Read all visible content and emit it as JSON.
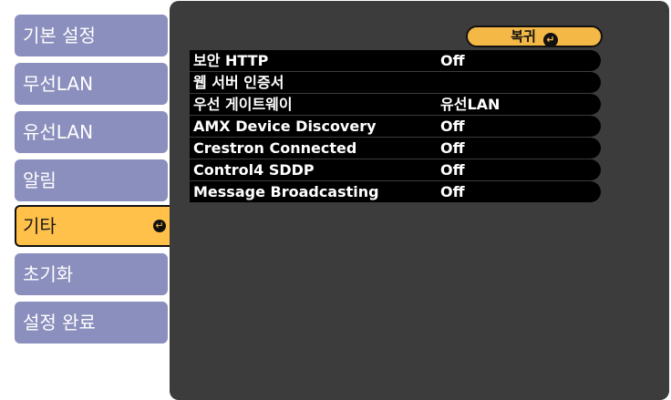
{
  "sidebar": {
    "items": [
      {
        "label": "기본 설정"
      },
      {
        "label": "무선LAN"
      },
      {
        "label": "유선LAN"
      },
      {
        "label": "알림"
      },
      {
        "label": "기타"
      },
      {
        "label": "초기화"
      },
      {
        "label": "설정 완료"
      }
    ],
    "active_index": 4
  },
  "main": {
    "return_label": "복귀",
    "rows": [
      {
        "label": "보안 HTTP",
        "value": "Off"
      },
      {
        "label": "웹 서버 인증서",
        "value": ""
      },
      {
        "label": "우선 게이트웨이",
        "value": "유선LAN"
      },
      {
        "label": "AMX Device Discovery",
        "value": "Off"
      },
      {
        "label": "Crestron Connected",
        "value": "Off"
      },
      {
        "label": "Control4 SDDP",
        "value": "Off"
      },
      {
        "label": "Message Broadcasting",
        "value": "Off"
      }
    ]
  },
  "colors": {
    "sidebar_item": "#8b8fbd",
    "sidebar_active": "#ffc14a",
    "panel_bg": "#3c3c3c",
    "row_bg": "#000000",
    "return_button": "#f3b845"
  },
  "icons": {
    "enter": "enter-icon",
    "return": "return-icon"
  }
}
